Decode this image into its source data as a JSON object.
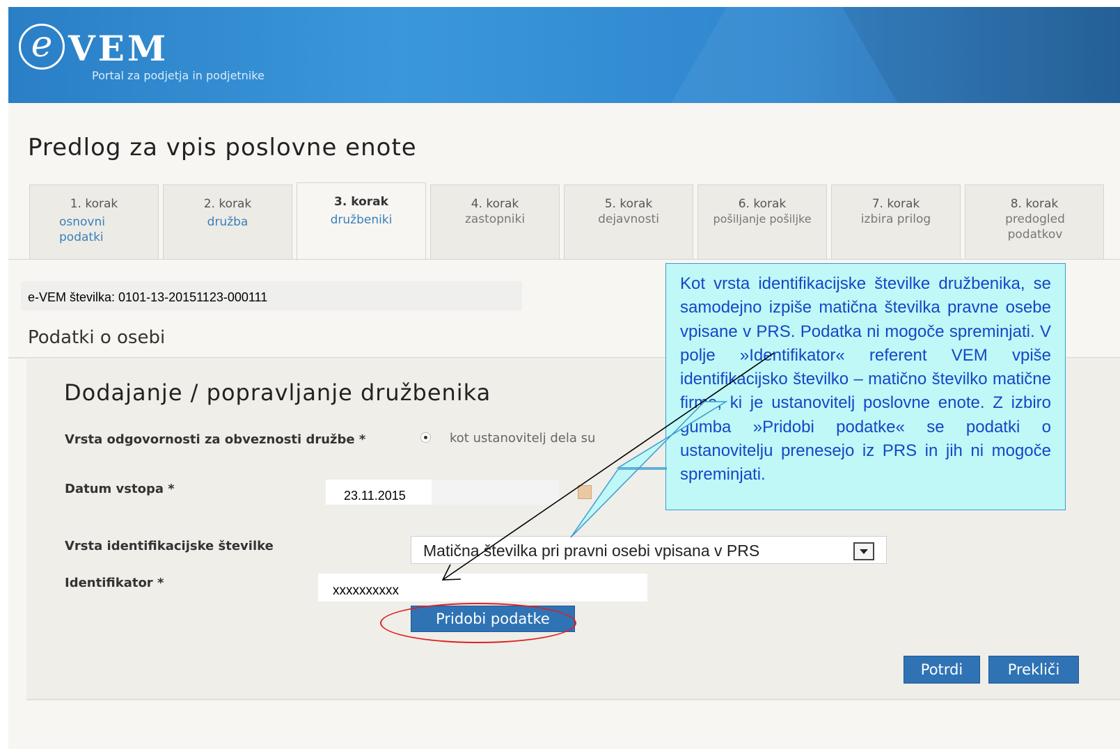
{
  "header": {
    "logo_e": "e",
    "logo_name": "VEM",
    "tagline": "Portal za podjetja in podjetnike"
  },
  "page": {
    "title": "Predlog za vpis poslovne enote"
  },
  "tabs": [
    {
      "step": "1. korak",
      "name": "osnovni podatki"
    },
    {
      "step": "2. korak",
      "name": "družba"
    },
    {
      "step": "3. korak",
      "name": "družbeniki"
    },
    {
      "step": "4. korak",
      "name": "zastopniki"
    },
    {
      "step": "5. korak",
      "name": "dejavnosti"
    },
    {
      "step": "6. korak",
      "name": "pošiljanje pošiljke"
    },
    {
      "step": "7. korak",
      "name": "izbira prilog"
    },
    {
      "step": "8. korak",
      "name": "predogled podatkov"
    }
  ],
  "evem_number": "e-VEM  številka: 0101-13-20151123-000111",
  "section_title": "Podatki o osebi",
  "form": {
    "title": "Dodajanje / popravljanje družbenika",
    "liability_label": "Vrsta odgovornosti za obveznosti družbe *",
    "liability_option": "kot ustanovitelj dela su",
    "date_label": "Datum vstopa *",
    "date_value": "23.11.2015",
    "id_type_label": "Vrsta identifikacijske številke",
    "id_type_value": "Matična številka pri pravni osebi vpisana v PRS",
    "identifier_label": "Identifikator *",
    "identifier_value": "xxxxxxxxxx",
    "fetch_button": "Pridobi podatke",
    "confirm_button": "Potrdi",
    "cancel_button": "Prekliči"
  },
  "callout": {
    "text": "Kot vrsta identifikacijske številke družbenika, se samodejno izpiše matična številka pravne osebe vpisane v PRS. Podatka ni mogoče spreminjati. V polje »Identifikator« referent VEM vpiše identifikacijsko številko – matično številko matične firme, ki je ustanovitelj poslovne enote. Z izbiro gumba »Pridobi podatke« se podatki o ustanovitelju prenesejo iz PRS in jih ni mogoče spreminjati."
  },
  "colors": {
    "header_blue": "#2f86cf",
    "button_blue": "#2f73b5",
    "callout_bg": "#bff8f6",
    "callout_text": "#1646c8",
    "highlight_red": "#e02020"
  }
}
